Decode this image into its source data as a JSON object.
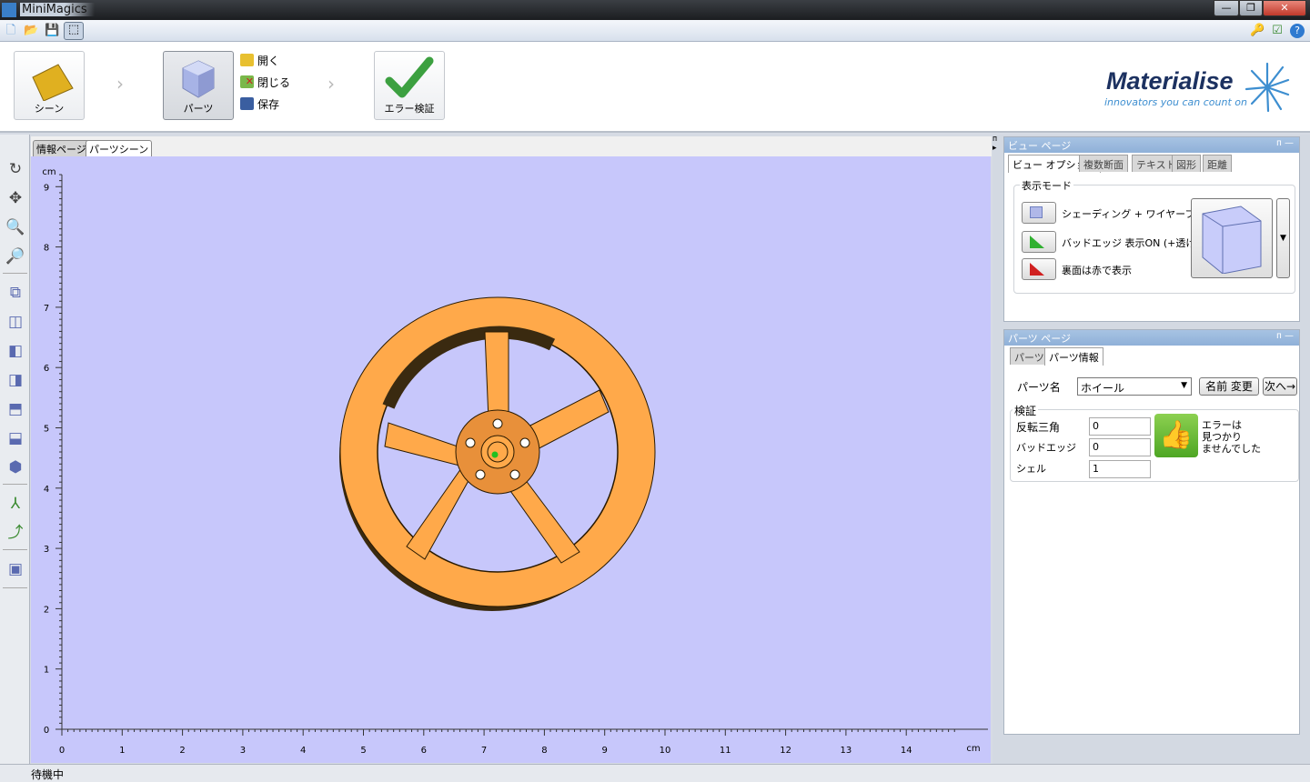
{
  "window": {
    "title": "MiniMagics",
    "controls": [
      "minimize",
      "restore",
      "close"
    ]
  },
  "quick_access": {
    "icons": [
      "new-file-icon",
      "open-folder-icon",
      "save-icon",
      "select-part-icon"
    ],
    "right_icons": [
      "key-icon",
      "checklist-icon",
      "help-icon"
    ]
  },
  "ribbon": {
    "scene_label": "シーン",
    "parts_label": "パーツ",
    "open_label": "開く",
    "close_label": "閉じる",
    "save_label": "保存",
    "check_label": "エラー検証"
  },
  "brand": {
    "name": "Materialise",
    "tagline": "innovators you can count on"
  },
  "view_tabs": [
    "情報ページ",
    "パーツシーン"
  ],
  "viewport": {
    "unit": "cm",
    "x_ticks": [
      "0",
      "1",
      "2",
      "3",
      "4",
      "5",
      "6",
      "7",
      "8",
      "9",
      "10",
      "11",
      "12",
      "13",
      "14"
    ],
    "y_ticks": [
      "0",
      "1",
      "2",
      "3",
      "4",
      "5",
      "6",
      "7",
      "8",
      "9"
    ],
    "x_unit": "cm",
    "background": "#c7c7fb",
    "part_color": "#ffa94a"
  },
  "view_page": {
    "title": "ビュー ページ",
    "tabs": [
      "ビュー オプション",
      "複数断面",
      "テキスト",
      "図形",
      "距離"
    ],
    "group_label": "表示モード",
    "modes": [
      "シェーディング + ワイヤーフレーム",
      "バッドエッジ 表示ON (+透け)",
      "裏面は赤で表示"
    ]
  },
  "parts_page": {
    "title": "パーツ ページ",
    "tabs": [
      "パーツ",
      "パーツ情報"
    ],
    "part_name_label": "パーツ名",
    "part_name_value": "ホイール",
    "rename_button": "名前 変更",
    "next_button": "次へ→",
    "verify_label": "検証",
    "rows": [
      {
        "label": "反転三角",
        "value": "0"
      },
      {
        "label": "バッドエッジ",
        "value": "0"
      },
      {
        "label": "シェル",
        "value": "1"
      }
    ],
    "result_text_1": "エラーは",
    "result_text_2": "見つかり",
    "result_text_3": "ませんでした",
    "result_color": "#5cb82e"
  },
  "status": {
    "text": "待機中"
  }
}
